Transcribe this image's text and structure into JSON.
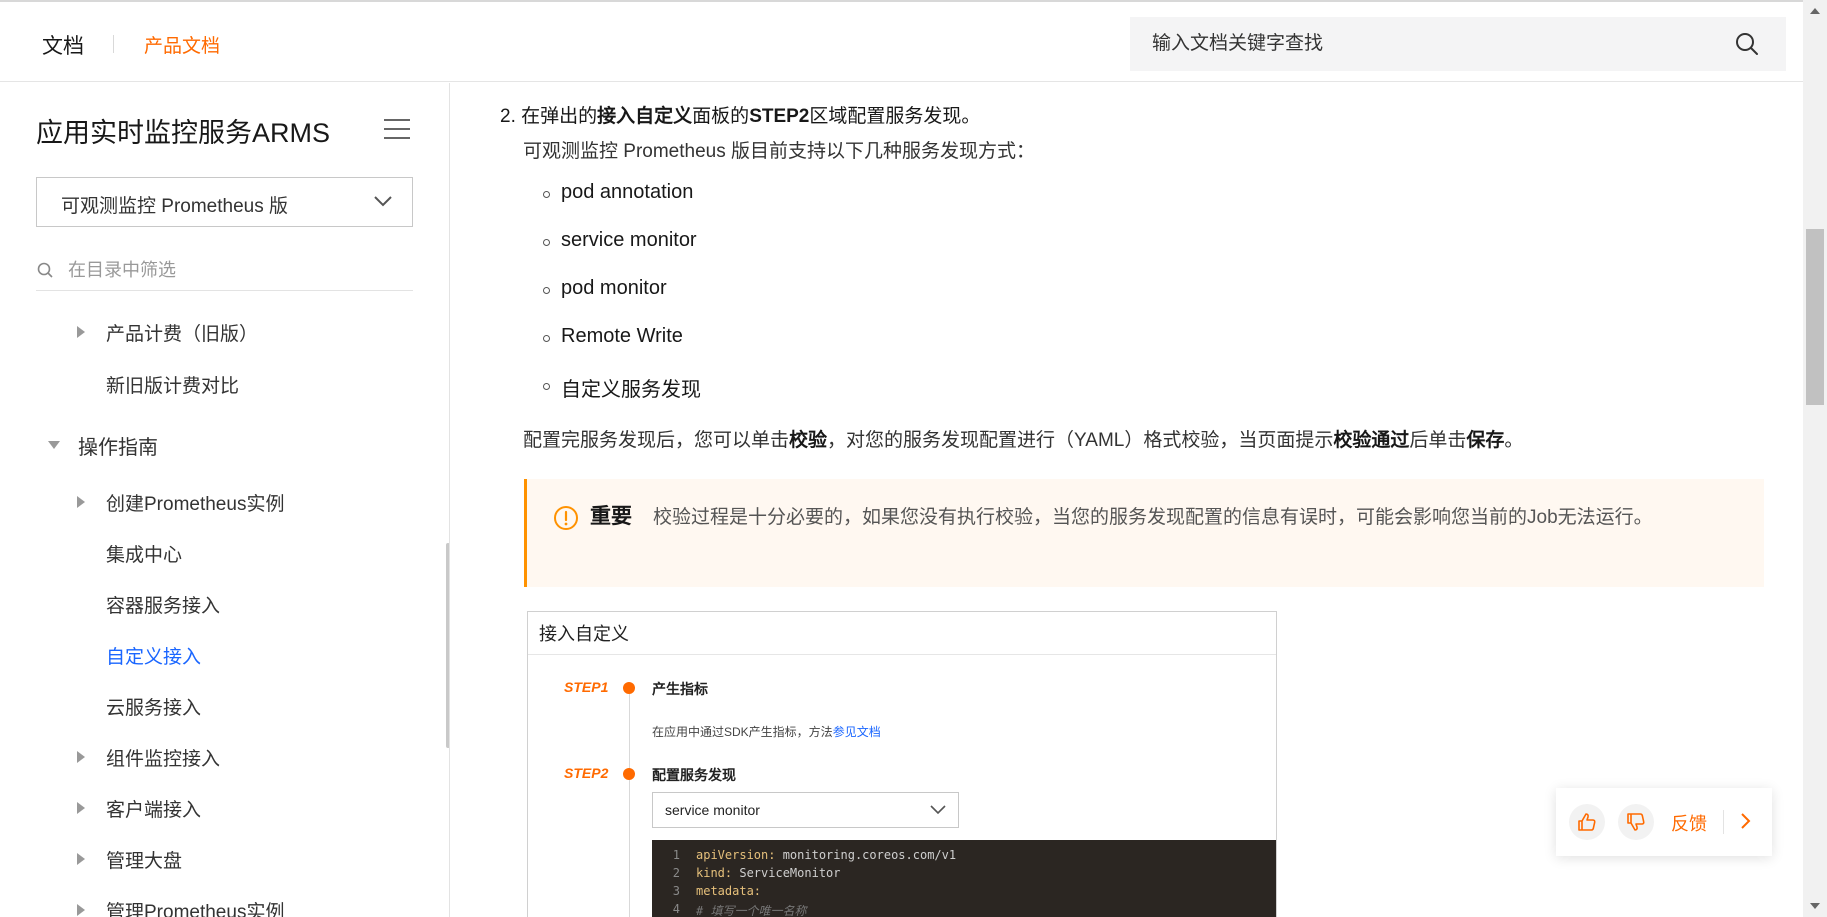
{
  "header": {
    "brand": "文档",
    "product_link": "产品文档",
    "search_placeholder": "输入文档关键字查找"
  },
  "sidebar": {
    "title": "应用实时监控服务ARMS",
    "product_select": "可观测监控 Prometheus 版",
    "filter_placeholder": "在目录中筛选",
    "items": [
      {
        "label": "产品计费（旧版）",
        "expandable": true
      },
      {
        "label": "新旧版计费对比",
        "expandable": false
      },
      {
        "label": "操作指南",
        "expandable": true,
        "expanded": true
      },
      {
        "label": "创建Prometheus实例",
        "expandable": true
      },
      {
        "label": "集成中心",
        "expandable": false
      },
      {
        "label": "容器服务接入",
        "expandable": false
      },
      {
        "label": "自定义接入",
        "expandable": false,
        "active": true
      },
      {
        "label": "云服务接入",
        "expandable": false
      },
      {
        "label": "组件监控接入",
        "expandable": true
      },
      {
        "label": "客户端接入",
        "expandable": true
      },
      {
        "label": "管理大盘",
        "expandable": true
      },
      {
        "label": "管理Prometheus实例",
        "expandable": true
      }
    ]
  },
  "content": {
    "step_num": "2.",
    "step_t1": "在弹出的",
    "step_b1": "接入自定义",
    "step_t2": "面板的",
    "step_b2": "STEP2",
    "step_t3": "区域配置服务发现。",
    "intro": "可观测监控 Prometheus 版目前支持以下几种服务发现方式：",
    "methods": [
      "pod annotation",
      "service monitor",
      "pod monitor",
      "Remote Write",
      "自定义服务发现"
    ],
    "after_t1": "配置完服务发现后，您可以单击",
    "after_b1": "校验",
    "after_t2": "，对您的服务发现配置进行（YAML）格式校验，当页面提示",
    "after_b2": "校验通过",
    "after_t3": "后单击",
    "after_b3": "保存",
    "after_t4": "。",
    "notice_title": "重要",
    "notice_text": "校验过程是十分必要的，如果您没有执行校验，当您的服务发现配置的信息有误时，可能会影响您当前的Job无法运行。"
  },
  "panel": {
    "title": "接入自定义",
    "step1_label": "STEP1",
    "step1_head": "产生指标",
    "step1_desc": "在应用中通过SDK产生指标，方法",
    "step1_link": "参见文档",
    "step2_label": "STEP2",
    "step2_head": "配置服务发现",
    "select_value": "service monitor",
    "code": [
      {
        "n": "1",
        "key": "apiVersion:",
        "val": " monitoring.coreos.com/v1"
      },
      {
        "n": "2",
        "key": "kind:",
        "val": " ServiceMonitor"
      },
      {
        "n": "3",
        "key": "metadata:",
        "val": ""
      },
      {
        "n": "4",
        "key": "",
        "val": "  #  填写一个唯一名称"
      }
    ]
  },
  "feedback": {
    "label": "反馈"
  },
  "colors": {
    "accent": "#ff6a00",
    "link": "#1a66ff",
    "notice_border": "#ff9200",
    "notice_bg": "#fff8f1"
  }
}
